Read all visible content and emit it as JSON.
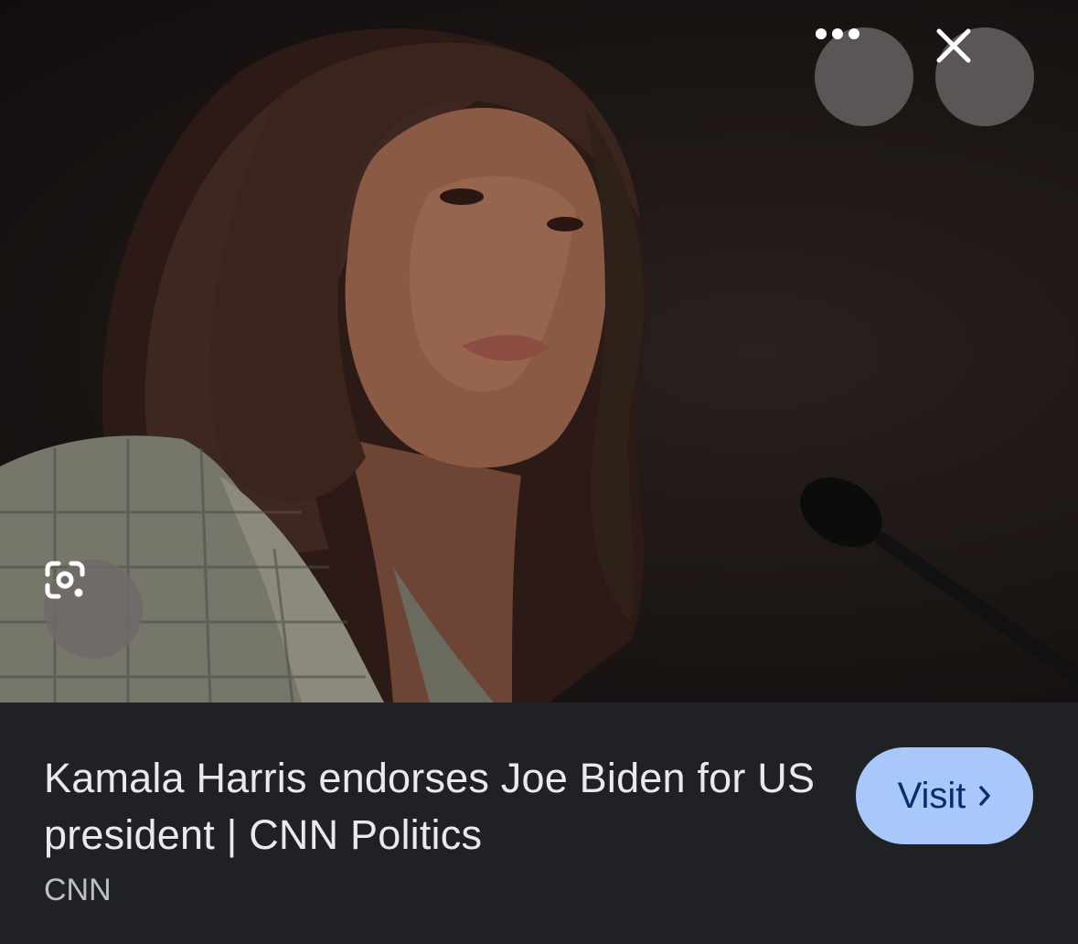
{
  "image": {
    "alt": "Kamala Harris"
  },
  "controls": {
    "more_icon": "more-horizontal-icon",
    "close_icon": "close-icon",
    "lens_icon": "google-lens-icon"
  },
  "result": {
    "title": "Kamala Harris endorses Joe Biden for US president | CNN Politics",
    "source": "CNN",
    "visit_label": "Visit",
    "visit_icon": "chevron-right-icon"
  },
  "colors": {
    "background": "#202124",
    "visit_button": "#a8c7fa",
    "visit_text": "#062e6f",
    "title_text": "#e8eaed"
  }
}
